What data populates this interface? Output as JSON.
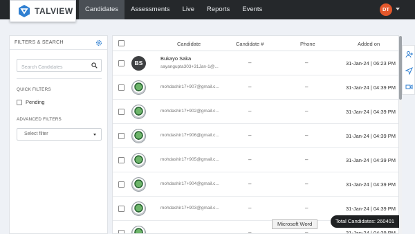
{
  "app": {
    "logo_text": "TALVIEW"
  },
  "nav": {
    "items": [
      "Candidates",
      "Assessments",
      "Live",
      "Reports",
      "Events"
    ],
    "active": "Candidates",
    "user_initials": "DT"
  },
  "filters": {
    "title": "FILTERS & SEARCH",
    "search_placeholder": "Search Candidates",
    "quick_filters_label": "QUICK FILTERS",
    "pending_label": "Pending",
    "advanced_filters_label": "ADVANCED FILTERS",
    "select_filter": "Select filter"
  },
  "table": {
    "columns": [
      "Candidate",
      "Candidate #",
      "Phone",
      "Added on"
    ],
    "rows": [
      {
        "initials": "BS",
        "name": "Bukayo Saka",
        "email": "sayangupta303+31Jan-1@...",
        "candidate_no": "–",
        "phone": "–",
        "added_on": "31-Jan-24 | 06:23 PM"
      },
      {
        "initials": "",
        "name": "",
        "email": "mohdashir17+907@gmail.c...",
        "candidate_no": "–",
        "phone": "–",
        "added_on": "31-Jan-24 | 04:39 PM"
      },
      {
        "initials": "",
        "name": "",
        "email": "mohdashir17+902@gmail.c...",
        "candidate_no": "–",
        "phone": "–",
        "added_on": "31-Jan-24 | 04:39 PM"
      },
      {
        "initials": "",
        "name": "",
        "email": "mohdashir17+906@gmail.c...",
        "candidate_no": "–",
        "phone": "–",
        "added_on": "31-Jan-24 | 04:39 PM"
      },
      {
        "initials": "",
        "name": "",
        "email": "mohdashir17+905@gmail.c...",
        "candidate_no": "–",
        "phone": "–",
        "added_on": "31-Jan-24 | 04:39 PM"
      },
      {
        "initials": "",
        "name": "",
        "email": "mohdashir17+904@gmail.c...",
        "candidate_no": "–",
        "phone": "–",
        "added_on": "31-Jan-24 | 04:39 PM"
      },
      {
        "initials": "",
        "name": "",
        "email": "mohdashir17+903@gmail.c...",
        "candidate_no": "–",
        "phone": "–",
        "added_on": "31-Jan-24 | 04:39 PM"
      },
      {
        "initials": "",
        "name": "",
        "email": "",
        "candidate_no": "–",
        "phone": "–",
        "added_on": "31-Jan-24 | 04:39 PM"
      }
    ]
  },
  "footer": {
    "total_label": "Total Candidates: 260401",
    "tooltip": "Microsoft Word"
  },
  "rail": {
    "icons": [
      "add-user-icon",
      "send-icon",
      "video-icon"
    ]
  },
  "colors": {
    "topbar": "#25282b",
    "avatar_top": "#e3572b",
    "accent": "#2f7fd1"
  }
}
